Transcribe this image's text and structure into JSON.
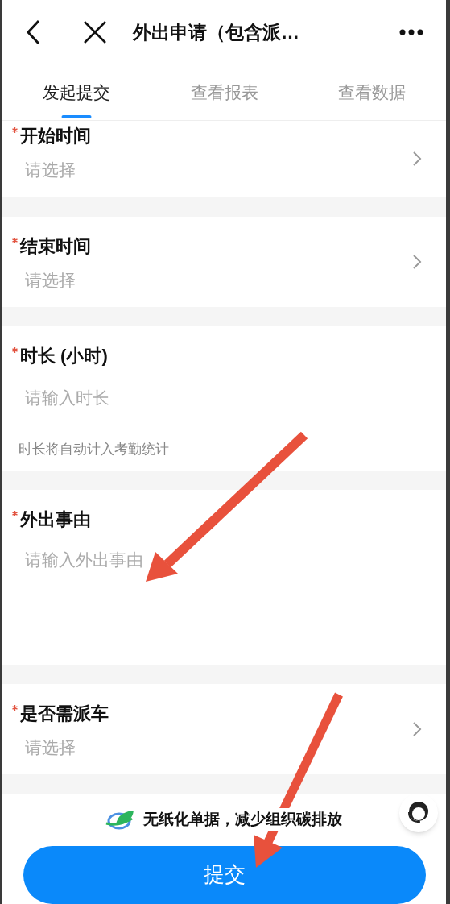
{
  "header": {
    "title": "外出申请（包含派…"
  },
  "tabs": [
    {
      "label": "发起提交",
      "selected": true
    },
    {
      "label": "查看报表",
      "selected": false
    },
    {
      "label": "查看数据",
      "selected": false
    }
  ],
  "fields": [
    {
      "kind": "select",
      "label": "开始时间",
      "required": true,
      "placeholder": "请选择"
    },
    {
      "kind": "select",
      "label": "结束时间",
      "required": true,
      "placeholder": "请选择"
    },
    {
      "kind": "input",
      "label": "时长 (小时)",
      "required": true,
      "placeholder": "请输入时长",
      "note": "时长将自动计入考勤统计"
    },
    {
      "kind": "textarea",
      "label": "外出事由",
      "required": true,
      "placeholder": "请输入外出事由"
    },
    {
      "kind": "select",
      "label": "是否需派车",
      "required": true,
      "placeholder": "请选择"
    }
  ],
  "footer": {
    "slogan": "无纸化单据，减少组织碳排放",
    "submit": "提交"
  }
}
